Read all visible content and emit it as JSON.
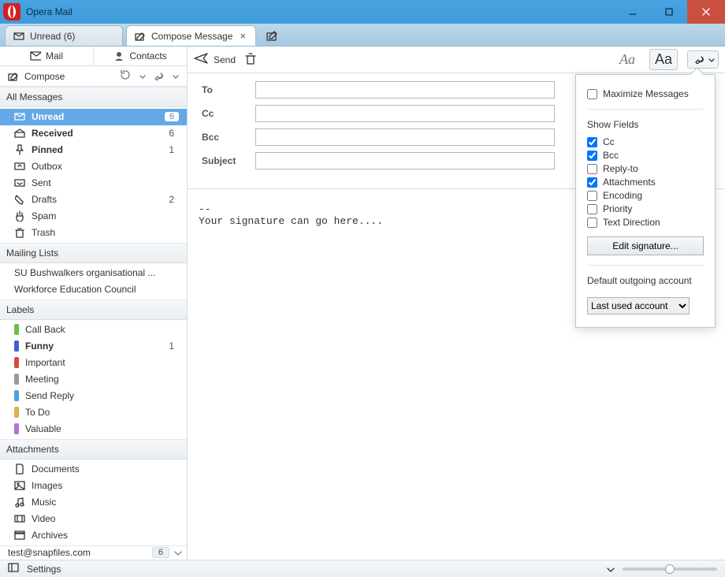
{
  "window": {
    "title": "Opera Mail"
  },
  "tabs": {
    "t0": {
      "label": "Unread (6)"
    },
    "t1": {
      "label": "Compose Message"
    }
  },
  "sidetabs": {
    "mail": "Mail",
    "contacts": "Contacts"
  },
  "compose_btn": "Compose",
  "categories": {
    "all": "All Messages",
    "mailing": "Mailing Lists",
    "labels": "Labels",
    "attachments": "Attachments"
  },
  "folders": {
    "unread": {
      "label": "Unread",
      "count": "6"
    },
    "received": {
      "label": "Received",
      "count": "6"
    },
    "pinned": {
      "label": "Pinned",
      "count": "1"
    },
    "outbox": {
      "label": "Outbox",
      "count": ""
    },
    "sent": {
      "label": "Sent",
      "count": ""
    },
    "drafts": {
      "label": "Drafts",
      "count": "2"
    },
    "spam": {
      "label": "Spam",
      "count": ""
    },
    "trash": {
      "label": "Trash",
      "count": ""
    }
  },
  "mailing_lists": {
    "m0": "SU Bushwalkers organisational ...",
    "m1": "Workforce Education Council"
  },
  "labels": {
    "l0": {
      "label": "Call Back",
      "color": "#6dbf4b",
      "count": ""
    },
    "l1": {
      "label": "Funny",
      "color": "#3a5fd9",
      "count": "1"
    },
    "l2": {
      "label": "Important",
      "color": "#d94a3a",
      "count": ""
    },
    "l3": {
      "label": "Meeting",
      "color": "#9a9a9a",
      "count": ""
    },
    "l4": {
      "label": "Send Reply",
      "color": "#4aa3e0",
      "count": ""
    },
    "l5": {
      "label": "To Do",
      "color": "#e0b24a",
      "count": ""
    },
    "l6": {
      "label": "Valuable",
      "color": "#b56fd9",
      "count": ""
    }
  },
  "attachments": {
    "a0": "Documents",
    "a1": "Images",
    "a2": "Music",
    "a3": "Video",
    "a4": "Archives"
  },
  "account": {
    "email": "test@snapfiles.com",
    "count": "6"
  },
  "toolbar": {
    "send": "Send"
  },
  "fields": {
    "to": "To",
    "cc": "Cc",
    "bcc": "Bcc",
    "subject": "Subject"
  },
  "body": "--\nYour signature can go here....",
  "popup": {
    "maximize": "Maximize Messages",
    "showfields_heading": "Show Fields",
    "sf_cc": "Cc",
    "sf_bcc": "Bcc",
    "sf_replyto": "Reply-to",
    "sf_attachments": "Attachments",
    "sf_encoding": "Encoding",
    "sf_priority": "Priority",
    "sf_textdir": "Text Direction",
    "edit_sig": "Edit signature...",
    "default_acct_heading": "Default outgoing account",
    "default_acct_value": "Last used account"
  },
  "statusbar": {
    "settings": "Settings"
  }
}
